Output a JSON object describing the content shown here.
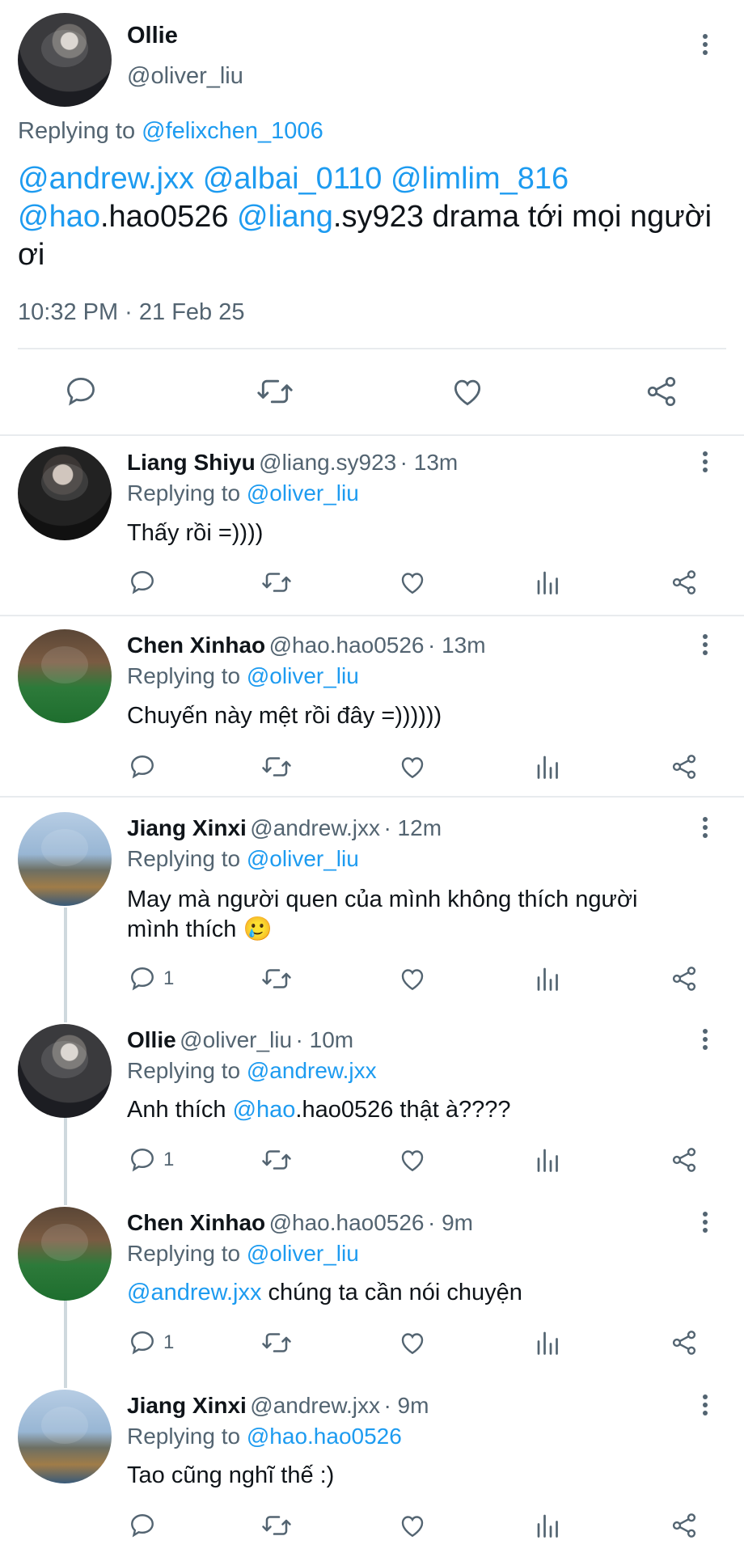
{
  "main_tweet": {
    "name": "Ollie",
    "handle": "@oliver_liu",
    "replying_prefix": "Replying to ",
    "replying_to": "@felixchen_1006",
    "text_parts": [
      {
        "t": "@andrew.jxx",
        "link": true
      },
      {
        "t": " ",
        "link": false
      },
      {
        "t": "@albai_0110",
        "link": true
      },
      {
        "t": " ",
        "link": false
      },
      {
        "t": "@limlim_816",
        "link": true
      },
      {
        "t": " ",
        "link": false
      },
      {
        "t": "@hao",
        "link": true
      },
      {
        "t": ".hao0526 ",
        "link": false
      },
      {
        "t": "@liang",
        "link": true
      },
      {
        "t": ".sy923 drama tới mọi người ơi",
        "link": false
      }
    ],
    "timestamp": "10:32 PM · 21 Feb 25"
  },
  "replies": [
    {
      "name": "Liang Shiyu",
      "handle": "@liang.sy923",
      "time": "· 13m",
      "replying_prefix": "Replying to ",
      "replying_to": "@oliver_liu",
      "text": "Thấy rồi =))))",
      "reply_count": ""
    },
    {
      "name": "Chen Xinhao",
      "handle": "@hao.hao0526",
      "time": "· 13m",
      "replying_prefix": "Replying to ",
      "replying_to": "@oliver_liu",
      "text": "Chuyến này mệt rồi đây =))))))",
      "reply_count": ""
    },
    {
      "name": "Jiang Xinxi",
      "handle": "@andrew.jxx",
      "time": "· 12m",
      "replying_prefix": "Replying to ",
      "replying_to": "@oliver_liu",
      "text_line1": "May mà người quen của mình không thích người",
      "text_line2": "mình thích",
      "emoji": "🥲",
      "reply_count": "1"
    },
    {
      "name": "Ollie",
      "handle": "@oliver_liu",
      "time": "· 10m",
      "replying_prefix": "Replying to ",
      "replying_to": "@andrew.jxx",
      "text_pre": "Anh thích ",
      "text_mention": "@hao",
      "text_post": ".hao0526 thật à????",
      "reply_count": "1"
    },
    {
      "name": "Chen Xinhao",
      "handle": "@hao.hao0526",
      "time": "· 9m",
      "replying_prefix": "Replying to ",
      "replying_to": "@oliver_liu",
      "text_mention": "@andrew.jxx",
      "text_post": " chúng ta cần nói chuyện",
      "reply_count": "1"
    },
    {
      "name": "Jiang Xinxi",
      "handle": "@andrew.jxx",
      "time": "· 9m",
      "replying_prefix": "Replying to ",
      "replying_to": "@hao.hao0526",
      "text": "Tao cũng nghĩ thế :)",
      "reply_count": ""
    }
  ],
  "icons": {
    "reply": "reply-icon",
    "retweet": "retweet-icon",
    "like": "like-icon",
    "views": "views-icon",
    "share": "share-icon",
    "more": "more-icon"
  },
  "colors": {
    "link": "#1d9bf0",
    "muted": "#536471",
    "text": "#0f1419",
    "divider": "#e8ebee"
  }
}
